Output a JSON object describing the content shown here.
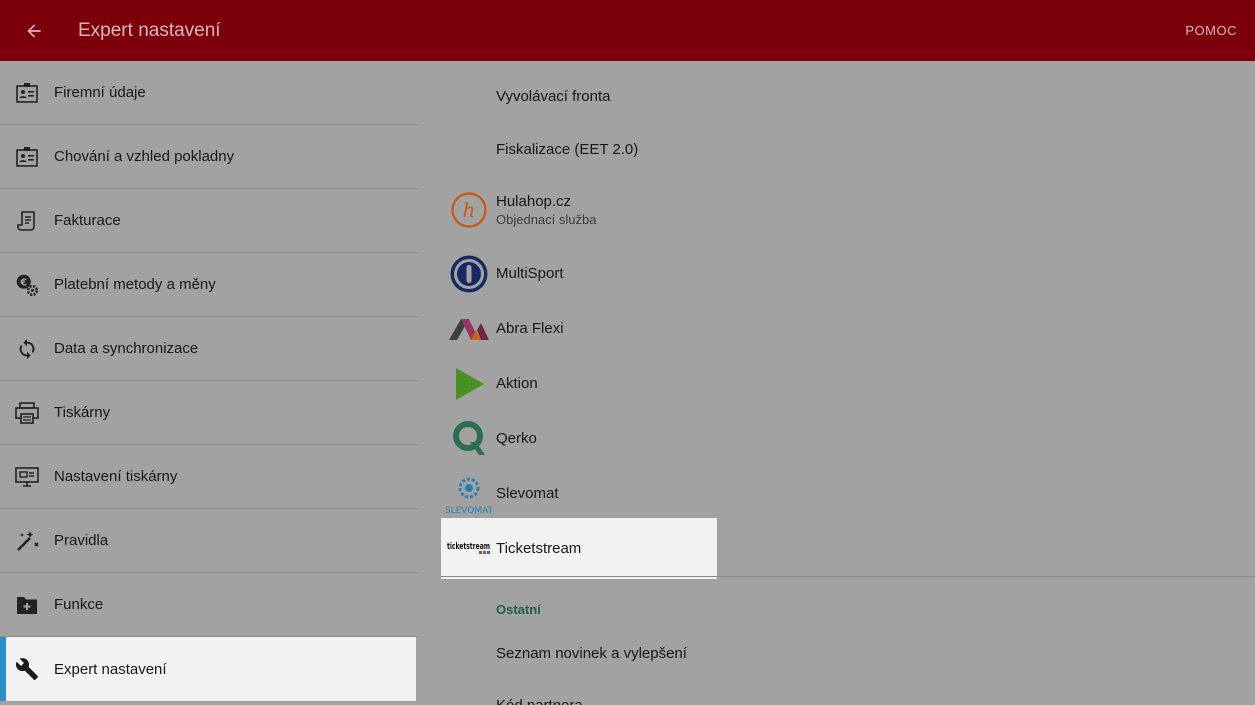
{
  "appbar": {
    "title": "Expert nastavení",
    "help_label": "POMOC"
  },
  "sidebar": {
    "items": [
      {
        "label": "Firemní údaje",
        "icon": "contact-card-icon"
      },
      {
        "label": "Chování a vzhled pokladny",
        "icon": "contact-card-icon"
      },
      {
        "label": "Fakturace",
        "icon": "invoice-scroll-icon"
      },
      {
        "label": "Platební metody a měny",
        "icon": "currency-gear-icon"
      },
      {
        "label": "Data a synchronizace",
        "icon": "sync-icon"
      },
      {
        "label": "Tiskárny",
        "icon": "printer-icon"
      },
      {
        "label": "Nastavení tiskárny",
        "icon": "printer-settings-icon"
      },
      {
        "label": "Pravidla",
        "icon": "magic-wand-icon"
      },
      {
        "label": "Funkce",
        "icon": "folder-plus-icon"
      },
      {
        "label": "Expert nastavení",
        "icon": "wrench-icon",
        "active": true
      }
    ]
  },
  "content": {
    "rows": [
      {
        "title": "Vyvolávací fronta"
      },
      {
        "title": "Fiskalizace (EET 2.0)"
      },
      {
        "title": "Hulahop.cz",
        "subtitle": "Objednací služba",
        "icon": "hulahop-logo"
      },
      {
        "title": "MultiSport",
        "icon": "multisport-logo"
      },
      {
        "title": "Abra Flexi",
        "icon": "abra-flexi-logo"
      },
      {
        "title": "Aktion",
        "icon": "aktion-logo"
      },
      {
        "title": "Qerko",
        "icon": "qerko-logo"
      },
      {
        "title": "Slevomat",
        "icon": "slevomat-logo",
        "logo_text": "SLEVOMAT"
      },
      {
        "title": "Ticketstream",
        "icon": "ticketstream-logo",
        "logo_text": "ticketstream",
        "selected": true
      }
    ],
    "section_title": "Ostatní",
    "other_rows": [
      {
        "title": "Seznam novinek a vylepšení"
      },
      {
        "title": "Kód partnera"
      }
    ]
  },
  "colors": {
    "appbar": "#7b000b",
    "accent": "#2c8fc7",
    "section": "#1f5f4e",
    "dim_bg": "#a2a2a2",
    "selected_bg": "#f2f2f2"
  }
}
